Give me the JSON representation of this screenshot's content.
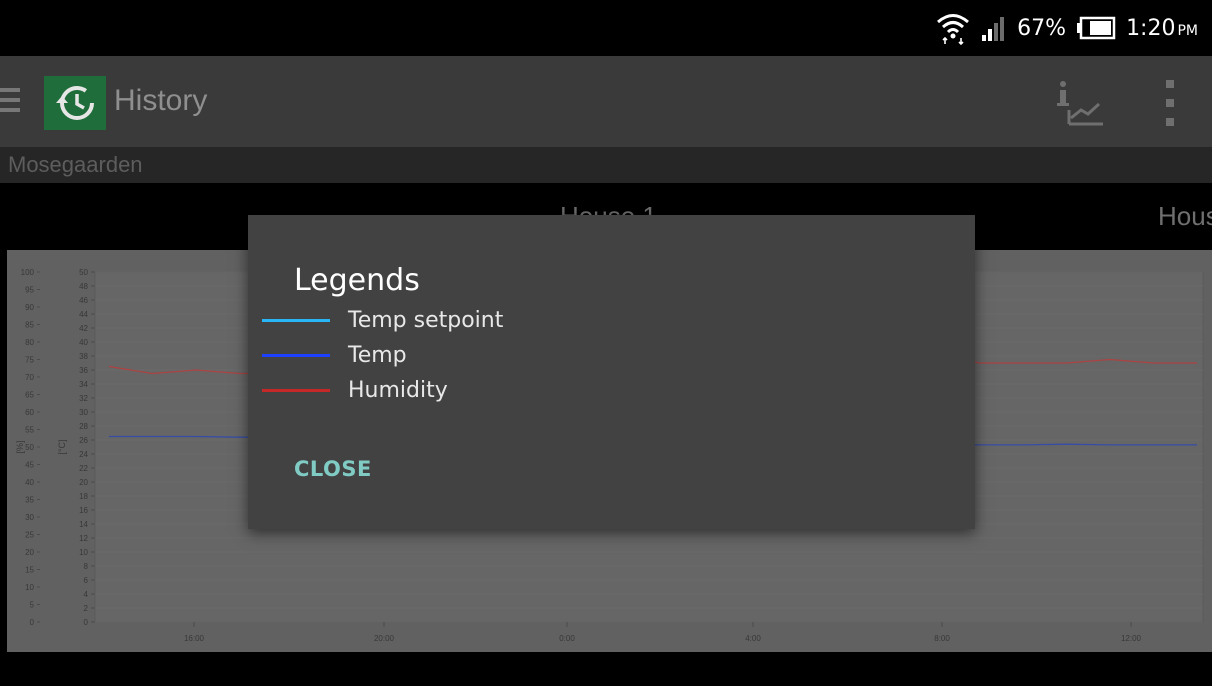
{
  "status_bar": {
    "battery": "67%",
    "time": "1:20",
    "ampm": "PM"
  },
  "app_bar": {
    "title": "History",
    "icon": "history-icon",
    "actions": [
      "chart-info-icon",
      "more-vert-icon"
    ]
  },
  "subtitle": "Mosegaarden",
  "tabs": [
    "House 1",
    "Hous"
  ],
  "chart_data": {
    "type": "line",
    "left_axis": {
      "label": "[%]",
      "ticks": [
        100,
        95,
        90,
        85,
        80,
        75,
        70,
        65,
        60,
        55,
        50,
        45,
        40,
        35,
        30,
        25,
        20,
        15,
        10,
        5,
        0
      ]
    },
    "right_axis": {
      "label": "[°C]",
      "ticks": [
        50,
        48,
        46,
        44,
        42,
        40,
        38,
        36,
        34,
        32,
        30,
        28,
        26,
        24,
        22,
        20,
        18,
        16,
        14,
        12,
        10,
        8,
        6,
        4,
        2,
        0
      ]
    },
    "x_ticks": [
      "16:00",
      "20:00",
      "0:00",
      "4:00",
      "8:00",
      "12:00"
    ],
    "series": [
      {
        "name": "Humidity",
        "color": "#d32f2f",
        "values": [
          73,
          71,
          72,
          71,
          71,
          72,
          78,
          80,
          75,
          77,
          76,
          72,
          72,
          74,
          72,
          72,
          72,
          75,
          72,
          77,
          74,
          74,
          74,
          75,
          74,
          74
        ]
      },
      {
        "name": "Temp",
        "color": "#1e40c8",
        "values": [
          26.5,
          26.5,
          26.5,
          26.4,
          26.4,
          26.2,
          26.1,
          26.1,
          26.0,
          26.0,
          26.0,
          25.9,
          25.9,
          25.8,
          25.6,
          25.5,
          25.5,
          25.4,
          25.4,
          25.4,
          25.3,
          25.3,
          25.4,
          25.3,
          25.3,
          25.3
        ]
      }
    ]
  },
  "dialog": {
    "title": "Legends",
    "items": [
      {
        "label": "Temp setpoint",
        "color": "#29b6f6"
      },
      {
        "label": "Temp",
        "color": "#1e40ff"
      },
      {
        "label": "Humidity",
        "color": "#c62828"
      }
    ],
    "close_label": "CLOSE"
  }
}
